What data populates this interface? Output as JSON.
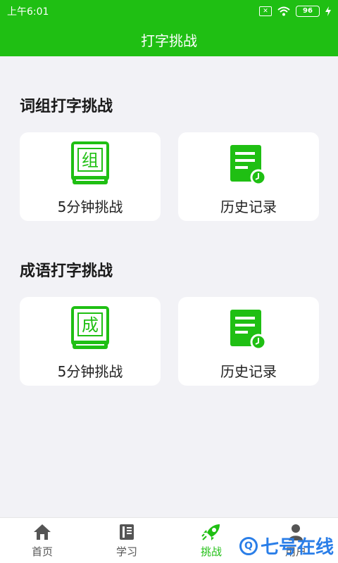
{
  "status": {
    "time": "上午6:01",
    "battery": "96"
  },
  "header": {
    "title": "打字挑战"
  },
  "sections": [
    {
      "title": "词组打字挑战",
      "book_char": "组",
      "cards": [
        {
          "label": "5分钟挑战"
        },
        {
          "label": "历史记录"
        }
      ]
    },
    {
      "title": "成语打字挑战",
      "book_char": "成",
      "cards": [
        {
          "label": "5分钟挑战"
        },
        {
          "label": "历史记录"
        }
      ]
    }
  ],
  "tabs": [
    {
      "label": "首页",
      "icon": "home-icon"
    },
    {
      "label": "学习",
      "icon": "book-icon"
    },
    {
      "label": "挑战",
      "icon": "rocket-icon",
      "active": true
    },
    {
      "label": "用户",
      "icon": "user-icon"
    }
  ],
  "watermark": {
    "text": "七号在线"
  },
  "colors": {
    "brand_green": "#1fbf13",
    "watermark_blue": "#2a7ee8"
  }
}
